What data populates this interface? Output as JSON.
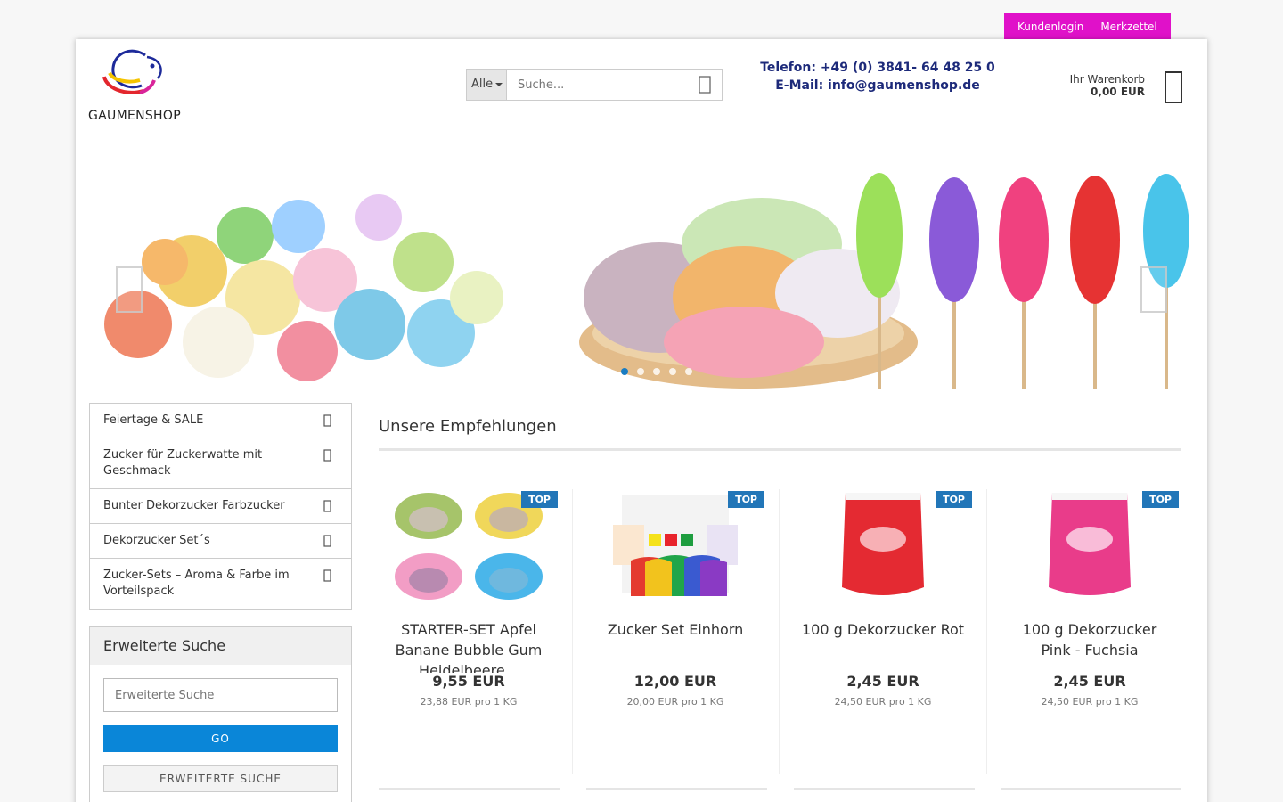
{
  "topbar": {
    "login": "Kundenlogin",
    "wishlist": "Merkzettel"
  },
  "logo": {
    "text": "GAUMENSHOP"
  },
  "search": {
    "category": "Alle",
    "placeholder": "Suche..."
  },
  "contact": {
    "phone": "Telefon: +49 (0) 3841- 64 48 25 0",
    "email": "E-Mail: info@gaumenshop.de"
  },
  "cart": {
    "label": "Ihr Warenkorb",
    "amount": "0,00 EUR"
  },
  "slider": {
    "dots": 7,
    "active_dot": 3
  },
  "categories": [
    {
      "label": "Feiertage & SALE"
    },
    {
      "label": "Zucker für Zuckerwatte mit Geschmack"
    },
    {
      "label": "Bunter Dekorzucker Farbzucker"
    },
    {
      "label": "Dekorzucker Set´s"
    },
    {
      "label": "Zucker-Sets – Aroma & Farbe im Vorteilspack"
    }
  ],
  "advanced_search": {
    "title": "Erweiterte Suche",
    "placeholder": "Erweiterte Suche",
    "go": "GO",
    "button": "ERWEITERTE SUCHE"
  },
  "recommendations": {
    "title": "Unsere Empfehlungen",
    "products": [
      {
        "badge": "TOP",
        "name": "STARTER-SET Apfel Banane Bubble Gum Heidelbeere...",
        "price": "9,55 EUR",
        "unit": "23,88 EUR pro 1 KG"
      },
      {
        "badge": "TOP",
        "name": "Zucker Set Einhorn",
        "price": "12,00 EUR",
        "unit": "20,00 EUR pro 1 KG"
      },
      {
        "badge": "TOP",
        "name": "100 g Dekorzucker Rot",
        "price": "2,45 EUR",
        "unit": "24,50 EUR pro 1 KG"
      },
      {
        "badge": "TOP",
        "name": "100 g Dekorzucker Pink - Fuchsia",
        "price": "2,45 EUR",
        "unit": "24,50 EUR pro 1 KG"
      }
    ]
  }
}
